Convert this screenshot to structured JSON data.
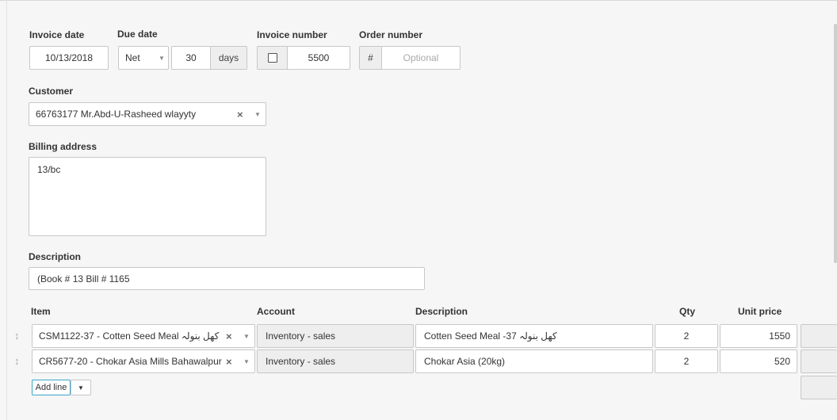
{
  "invoice_date": {
    "label": "Invoice date",
    "value": "10/13/2018"
  },
  "due_date": {
    "label": "Due date",
    "term": "Net",
    "days_value": "30",
    "days_suffix": "days"
  },
  "invoice_number": {
    "label": "Invoice number",
    "value": "5500"
  },
  "order_number": {
    "label": "Order number",
    "prefix": "#",
    "placeholder": "Optional"
  },
  "customer": {
    "label": "Customer",
    "value": "66763177 Mr.Abd-U-Rasheed wlayyty"
  },
  "billing_address": {
    "label": "Billing address",
    "value": "13/bc"
  },
  "description": {
    "label": "Description",
    "value": "(Book # 13 Bill # 1165"
  },
  "lines": {
    "headers": {
      "item": "Item",
      "account": "Account",
      "description": "Description",
      "qty": "Qty",
      "unit_price": "Unit price"
    },
    "rows": [
      {
        "item": "CSM1122-37 - Cotten Seed Meal کھل بنولہ",
        "account": "Inventory - sales",
        "description": "Cotten Seed Meal -37 کھل بنولہ",
        "qty": "2",
        "unit_price": "1550"
      },
      {
        "item": "CR5677-20 - Chokar Asia Mills Bahawalpur",
        "account": "Inventory - sales",
        "description": "Chokar Asia (20kg)",
        "qty": "2",
        "unit_price": "520"
      }
    ],
    "add_line_label": "Add line"
  },
  "icons": {
    "clear": "×",
    "caret": "▼",
    "drag_handle": "↕"
  }
}
